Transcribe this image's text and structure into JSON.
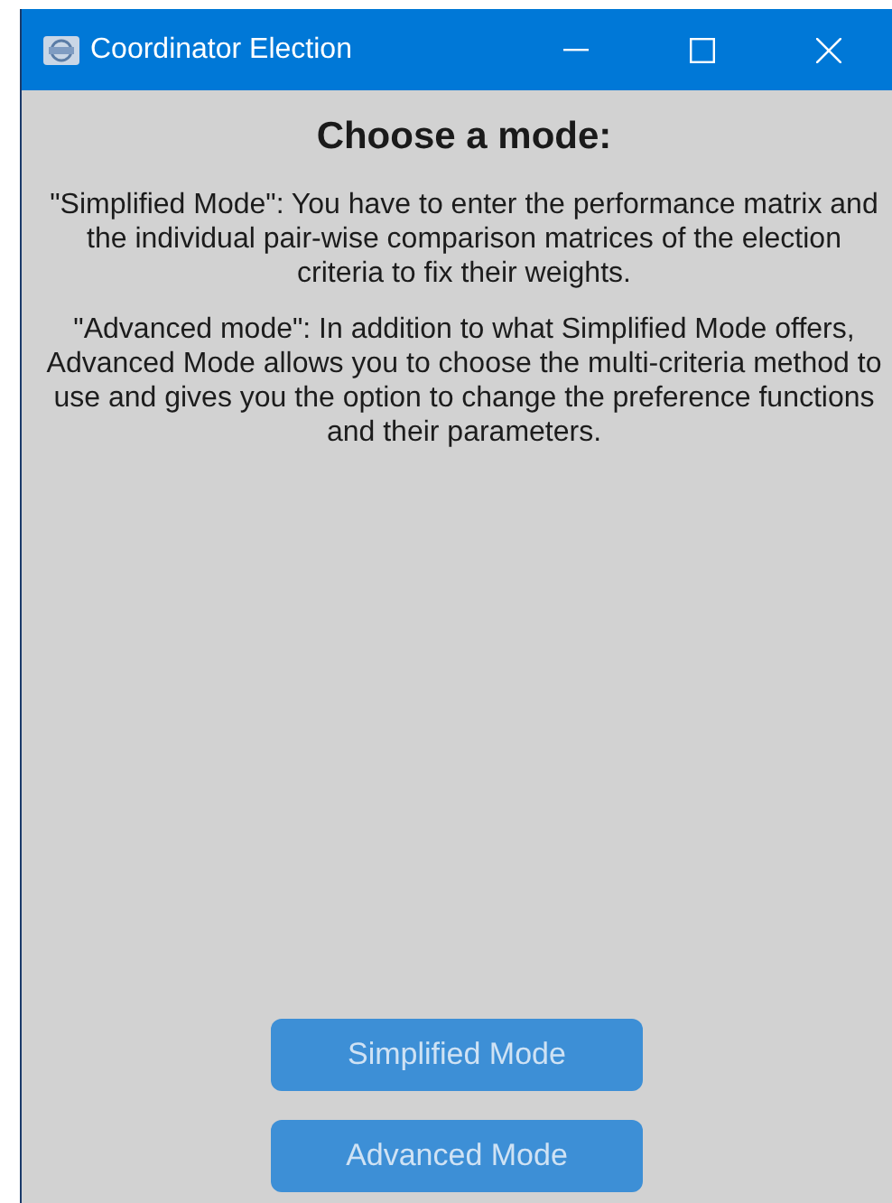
{
  "window": {
    "title": "Coordinator Election",
    "controls": [
      {
        "kind": "minimize"
      },
      {
        "kind": "maximize"
      },
      {
        "kind": "close"
      }
    ]
  },
  "heading": "Choose a mode:",
  "paragraphs": [
    "\"Simplified Mode\": You have to enter the performance matrix and the individual pair-wise comparison matrices of the election criteria to fix their weights.",
    "\"Advanced mode\": In addition to what Simplified Mode offers, Advanced Mode allows you to choose the multi-criteria method to use and gives you the option to change the preference functions and their parameters."
  ],
  "buttons": [
    "Simplified Mode",
    "Advanced Mode"
  ]
}
